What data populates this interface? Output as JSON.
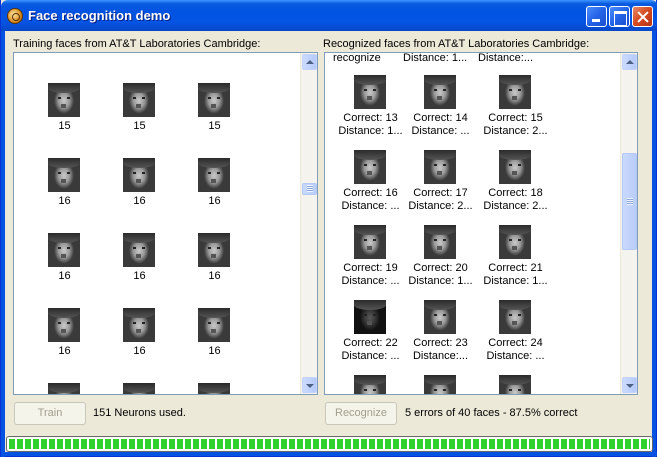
{
  "window": {
    "title": "Face recognition demo"
  },
  "training": {
    "label": "Training faces from AT&T Laboratories Cambridge:",
    "rows": [
      [
        "15",
        "15",
        "15"
      ],
      [
        "16",
        "16",
        "16"
      ],
      [
        "16",
        "16",
        "16"
      ],
      [
        "16",
        "16",
        "16"
      ],
      [
        "",
        "",
        ""
      ]
    ]
  },
  "recognized": {
    "label": "Recognized faces from AT&T Laboratories Cambridge:",
    "top_partial": [
      [
        "recognize"
      ],
      [
        "Distance: 1..."
      ],
      [
        "Distance:..."
      ]
    ],
    "rows": [
      [
        [
          "Correct: 13",
          "Distance: 1..."
        ],
        [
          "Correct: 14",
          "Distance: ..."
        ],
        [
          "Correct: 15",
          "Distance: 2..."
        ]
      ],
      [
        [
          "Correct: 16",
          "Distance: ..."
        ],
        [
          "Correct: 17",
          "Distance: 2..."
        ],
        [
          "Correct: 18",
          "Distance: 2..."
        ]
      ],
      [
        [
          "Correct: 19",
          "Distance: ..."
        ],
        [
          "Correct: 20",
          "Distance: 1..."
        ],
        [
          "Correct: 21",
          "Distance: 1..."
        ]
      ],
      [
        [
          "Correct: 22",
          "Distance: ..."
        ],
        [
          "Correct: 23",
          "Distance:..."
        ],
        [
          "Correct: 24",
          "Distance: ..."
        ]
      ],
      [
        [
          "",
          ""
        ],
        [
          "",
          ""
        ],
        [
          "",
          ""
        ]
      ]
    ]
  },
  "controls": {
    "train_label": "Train",
    "train_status": "151 Neurons used.",
    "recognize_label": "Recognize",
    "recognize_status": "5 errors of 40 faces - 87.5% correct"
  },
  "progress": {
    "percent": 100
  },
  "colors": {
    "titlebar": "#0553e0",
    "progress": "#2fd12f",
    "border": "#7f9db9"
  },
  "icons": {
    "app": "face-recognition-app-icon",
    "minimize": "minimize-icon",
    "maximize": "maximize-icon",
    "close": "close-icon"
  }
}
